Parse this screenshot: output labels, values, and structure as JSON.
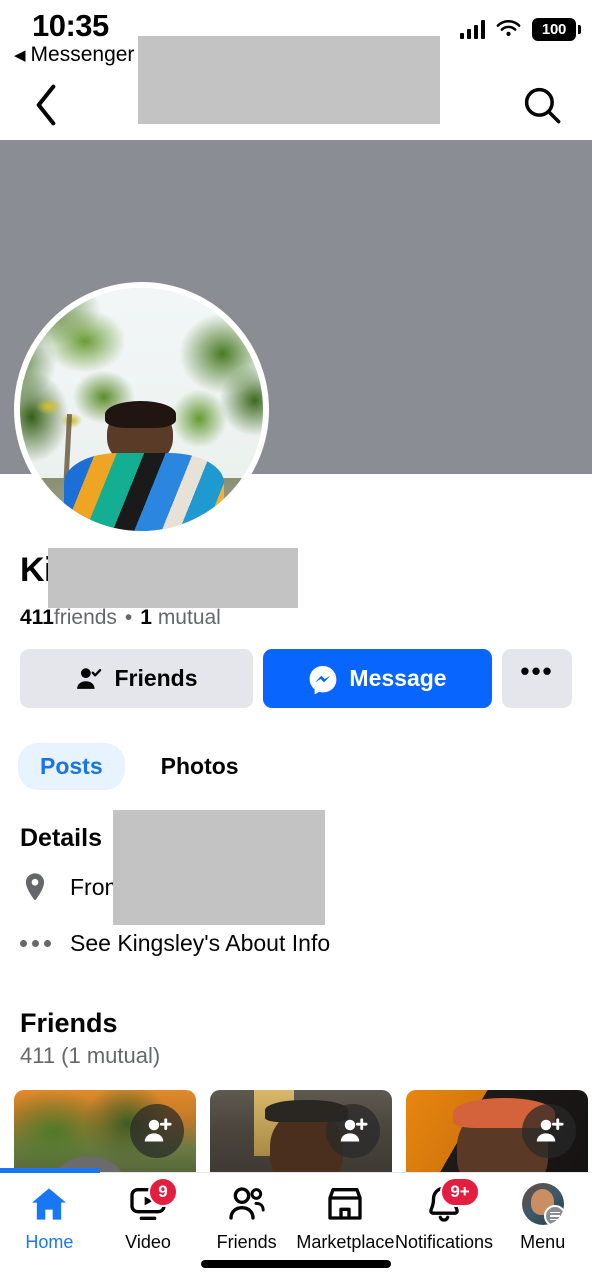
{
  "status_bar": {
    "time": "10:35",
    "return_app_label": "Messenger",
    "return_arrow": "◀",
    "battery_level": "100",
    "signal_icon": "cellular-signal-icon",
    "wifi_icon": "wifi-icon",
    "battery_icon": "battery-icon"
  },
  "app_header": {
    "back_icon": "chevron-left-icon",
    "search_icon": "search-icon",
    "title_redacted": true
  },
  "profile": {
    "name_visible_prefix": "Ki",
    "name_redacted": true,
    "friends_count": "411",
    "friends_word": "friends",
    "separator": "•",
    "mutual_count": "1",
    "mutual_word": "mutual",
    "cover_photo_color": "#8a8d93",
    "profile_photo_alt": "profile-photo"
  },
  "actions": {
    "friends_label": "Friends",
    "friends_icon": "person-check-icon",
    "message_label": "Message",
    "message_icon": "messenger-icon",
    "more_label": "•••",
    "message_color": "#0866ff",
    "secondary_color": "#e4e6eb"
  },
  "tabs": [
    {
      "label": "Posts",
      "active": true
    },
    {
      "label": "Photos",
      "active": false
    }
  ],
  "details": {
    "title": "Details",
    "rows": [
      {
        "icon": "location-pin-icon",
        "text": "From",
        "redacted": true
      },
      {
        "icon": "ellipsis-icon",
        "text": "See Kingsley's About Info",
        "redacted": true
      }
    ]
  },
  "friends_section": {
    "title": "Friends",
    "subtitle": "411 (1 mutual)",
    "cards": [
      {
        "name": "friend-card-1",
        "add_icon": "add-friend-icon"
      },
      {
        "name": "friend-card-2",
        "add_icon": "add-friend-icon"
      },
      {
        "name": "friend-card-3",
        "add_icon": "add-friend-icon"
      }
    ]
  },
  "bottom_nav": [
    {
      "label": "Home",
      "icon": "home-icon",
      "active": true,
      "badge": ""
    },
    {
      "label": "Video",
      "icon": "video-icon",
      "active": false,
      "badge": "9"
    },
    {
      "label": "Friends",
      "icon": "friends-icon",
      "active": false,
      "badge": ""
    },
    {
      "label": "Marketplace",
      "icon": "marketplace-icon",
      "active": false,
      "badge": ""
    },
    {
      "label": "Notifications",
      "icon": "bell-icon",
      "active": false,
      "badge": "9+"
    },
    {
      "label": "Menu",
      "icon": "menu-avatar-icon",
      "active": false,
      "badge": ""
    }
  ],
  "colors": {
    "facebook_blue": "#1877f2",
    "active_blue": "#0866ff",
    "tab_active_bg": "#e7f3ff",
    "badge_red": "#e41e3f",
    "redaction_gray": "#c3c3c3"
  }
}
